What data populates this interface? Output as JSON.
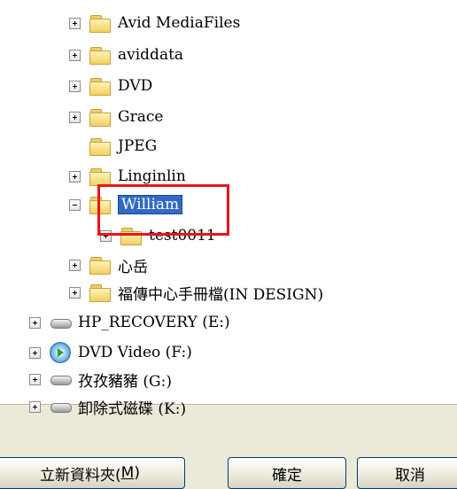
{
  "tree": {
    "items": [
      {
        "label": "Avid MediaFiles"
      },
      {
        "label": "aviddata"
      },
      {
        "label": "DVD"
      },
      {
        "label": "Grace"
      },
      {
        "label": "JPEG"
      },
      {
        "label": "Linginlin"
      },
      {
        "label": "William"
      },
      {
        "label": "test0011"
      },
      {
        "label": "心岳"
      },
      {
        "label": "福傳中心手冊檔(IN DESIGN)"
      },
      {
        "label": "HP_RECOVERY (E:)"
      },
      {
        "label": "DVD Video (F:)"
      },
      {
        "label": "孜孜豬豬 (G:)"
      },
      {
        "label": "卸除式磁碟 (K:)"
      }
    ],
    "selected": "William",
    "highlight_color": "#e8161b"
  },
  "buttons": {
    "new_folder": "立新資料夾(",
    "new_folder_key": "M",
    "new_folder_end": ")",
    "ok": "確定",
    "cancel": "取消"
  }
}
